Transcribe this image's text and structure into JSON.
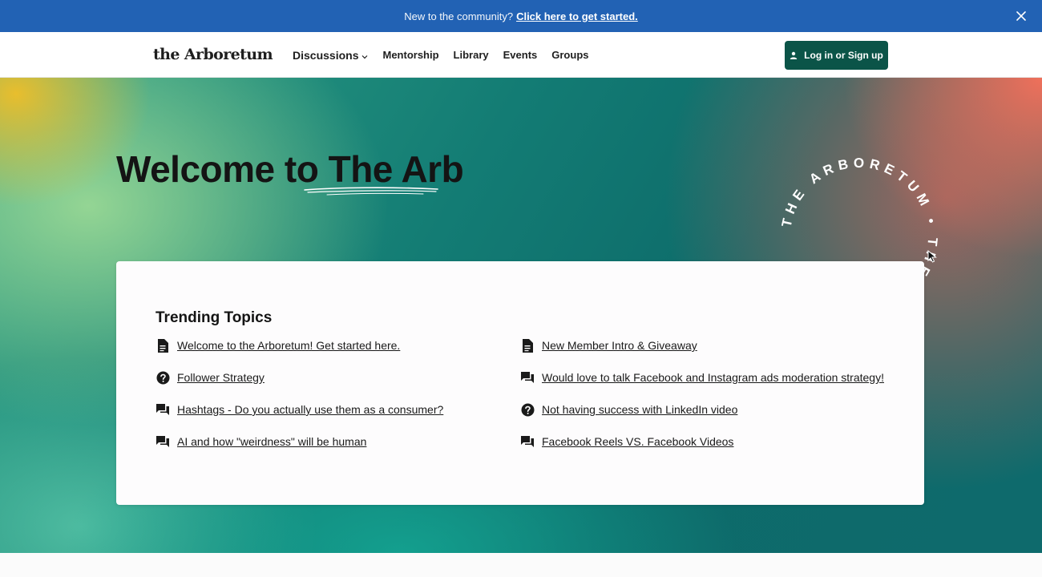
{
  "announcement": {
    "prefix": "New to the community?",
    "cta": "Click here to get started.",
    "close_icon": "close-icon",
    "background": "#2262b4"
  },
  "header": {
    "logo": "the Arboretum",
    "nav": [
      {
        "label": "Discussions",
        "has_dropdown": true
      },
      {
        "label": "Mentorship"
      },
      {
        "label": "Library"
      },
      {
        "label": "Events"
      },
      {
        "label": "Groups"
      }
    ],
    "login_label": "Log in or Sign up",
    "login_icon": "person-icon",
    "login_color": "#0b5448"
  },
  "hero": {
    "title": "Welcome to The Arb",
    "badge_text": "THE ARBORETUM • THE A"
  },
  "trending": {
    "title": "Trending Topics",
    "left": [
      {
        "icon": "document-icon",
        "label": "Welcome to the Arboretum! Get started here."
      },
      {
        "icon": "question-icon",
        "label": "Follower Strategy"
      },
      {
        "icon": "chat-icon",
        "label": "Hashtags - Do you actually use them as a consumer?"
      },
      {
        "icon": "chat-icon",
        "label": "AI and how \"weirdness\" will be human"
      }
    ],
    "right": [
      {
        "icon": "document-icon",
        "label": "New Member Intro & Giveaway"
      },
      {
        "icon": "chat-icon",
        "label": "Would love to talk Facebook and Instagram ads moderation strategy!"
      },
      {
        "icon": "question-icon",
        "label": "Not having success with LinkedIn video"
      },
      {
        "icon": "chat-icon",
        "label": "Facebook Reels VS. Facebook Videos"
      }
    ]
  }
}
